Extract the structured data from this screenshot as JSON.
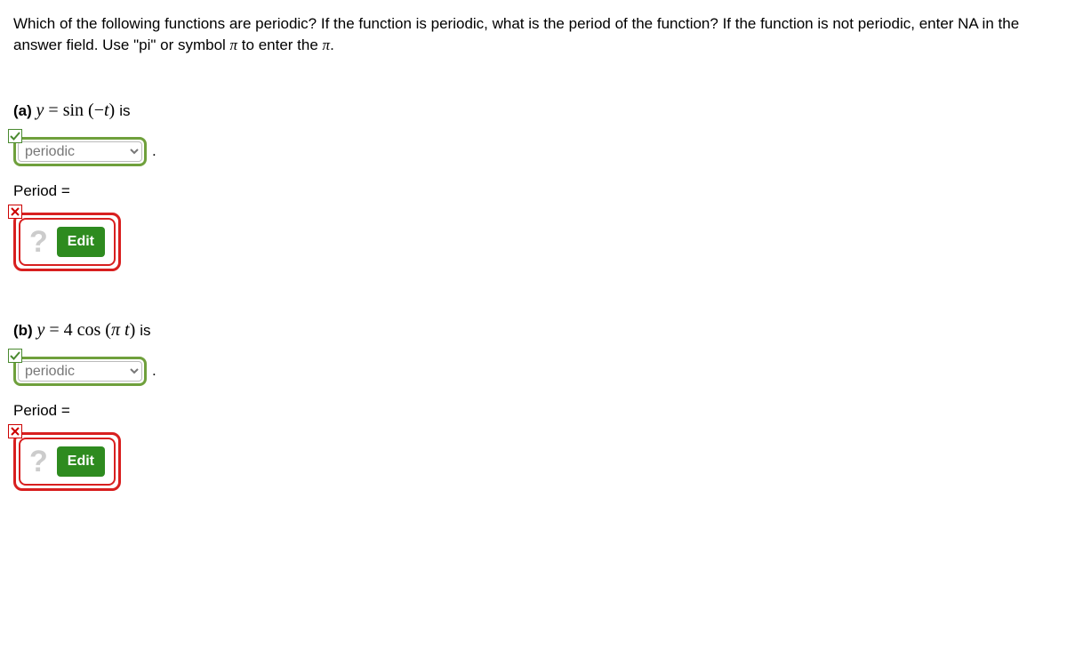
{
  "question": {
    "text_before_pi1": "Which of the following functions are periodic? If the function is periodic, what is the period of the function? If the function is not periodic, enter NA in the answer field. Use \"pi\" or symbol ",
    "pi1": "π",
    "text_mid": " to enter the ",
    "pi2": "π",
    "text_end": "."
  },
  "parts": [
    {
      "label": "(a)",
      "eq_lhs": "y",
      "eq_eq": " = ",
      "eq_func": "sin",
      "eq_open": "  (−",
      "eq_arg": "t",
      "eq_close": ")",
      "is_text": " is",
      "select_value": "periodic",
      "select_feedback": "correct",
      "period_label": "Period =",
      "edit_placeholder": "?",
      "edit_button": "Edit",
      "edit_feedback": "incorrect"
    },
    {
      "label": "(b)",
      "eq_lhs": "y",
      "eq_eq": " = ",
      "eq_coef": "4 ",
      "eq_func": "cos",
      "eq_open": "  (",
      "eq_pi": "π ",
      "eq_arg": "t",
      "eq_close": ")",
      "is_text": " is",
      "select_value": "periodic",
      "select_feedback": "correct",
      "period_label": "Period =",
      "edit_placeholder": "?",
      "edit_button": "Edit",
      "edit_feedback": "incorrect"
    }
  ]
}
